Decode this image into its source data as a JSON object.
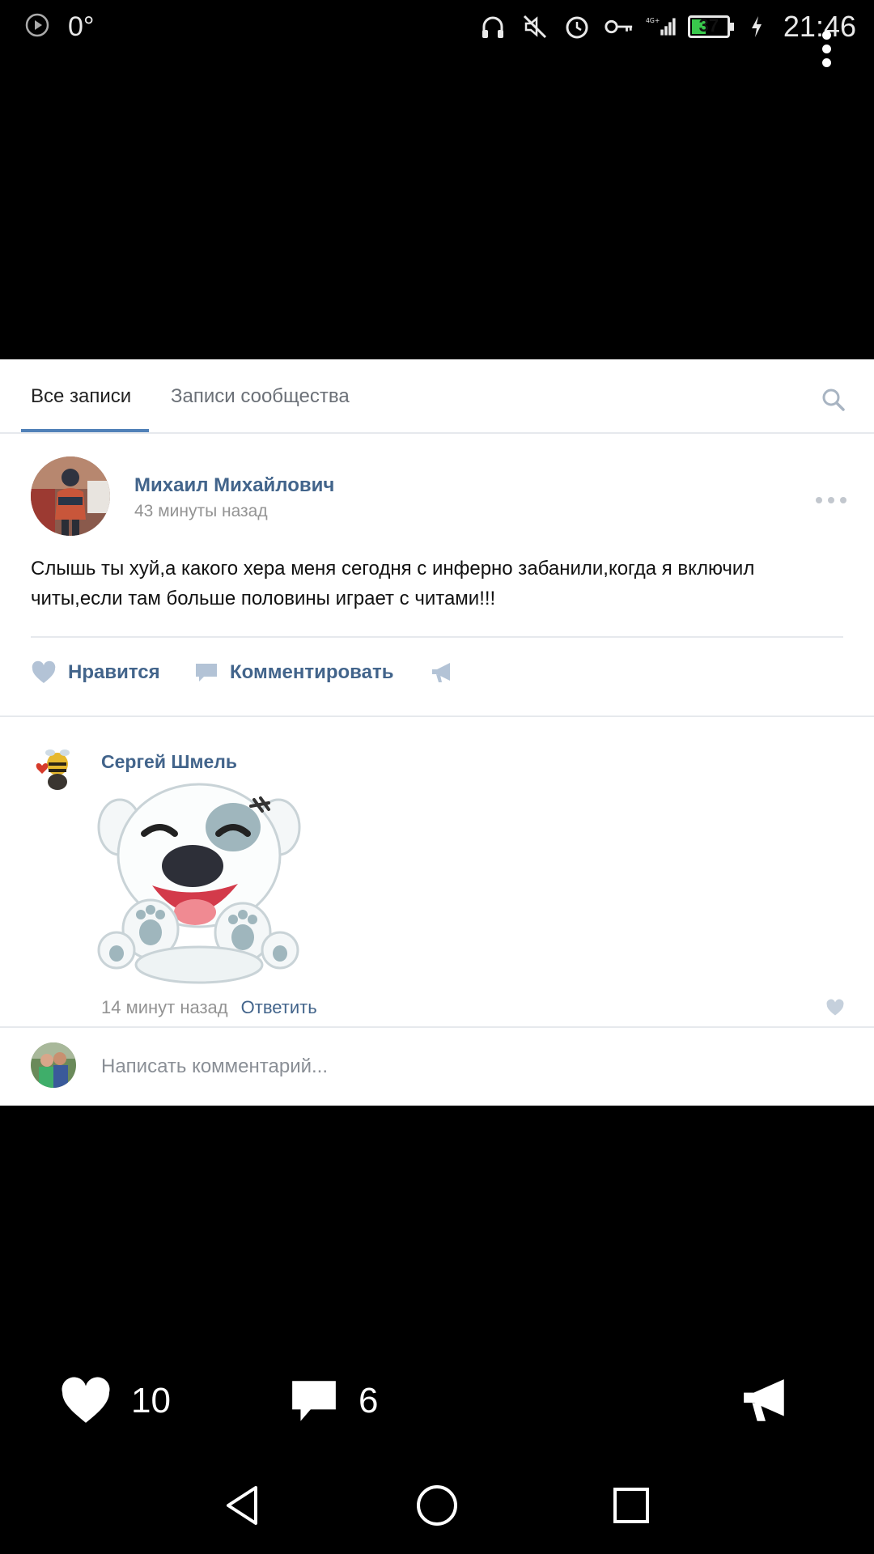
{
  "status_bar": {
    "temperature": "0°",
    "battery": "37",
    "time": "21:46",
    "network": "4G+"
  },
  "tabs": {
    "all_posts": "Все записи",
    "community_posts": "Записи сообщества"
  },
  "post": {
    "author": "Михаил Михайлович",
    "time": "43 минуты назад",
    "text": "Слышь ты хуй,а какого хера меня сегодня с инферно забанили,когда я включил читы,если там больше половины играет с читами!!!",
    "like_label": "Нравится",
    "comment_label": "Комментировать"
  },
  "comment": {
    "author": "Сергей Шмель",
    "time": "14 минут назад",
    "reply_label": "Ответить"
  },
  "comment_input": {
    "placeholder": "Написать комментарий..."
  },
  "bottom_bar": {
    "likes": "10",
    "comments": "6"
  },
  "colors": {
    "link": "#42648b",
    "accent": "#5181b8",
    "muted": "#939393"
  }
}
